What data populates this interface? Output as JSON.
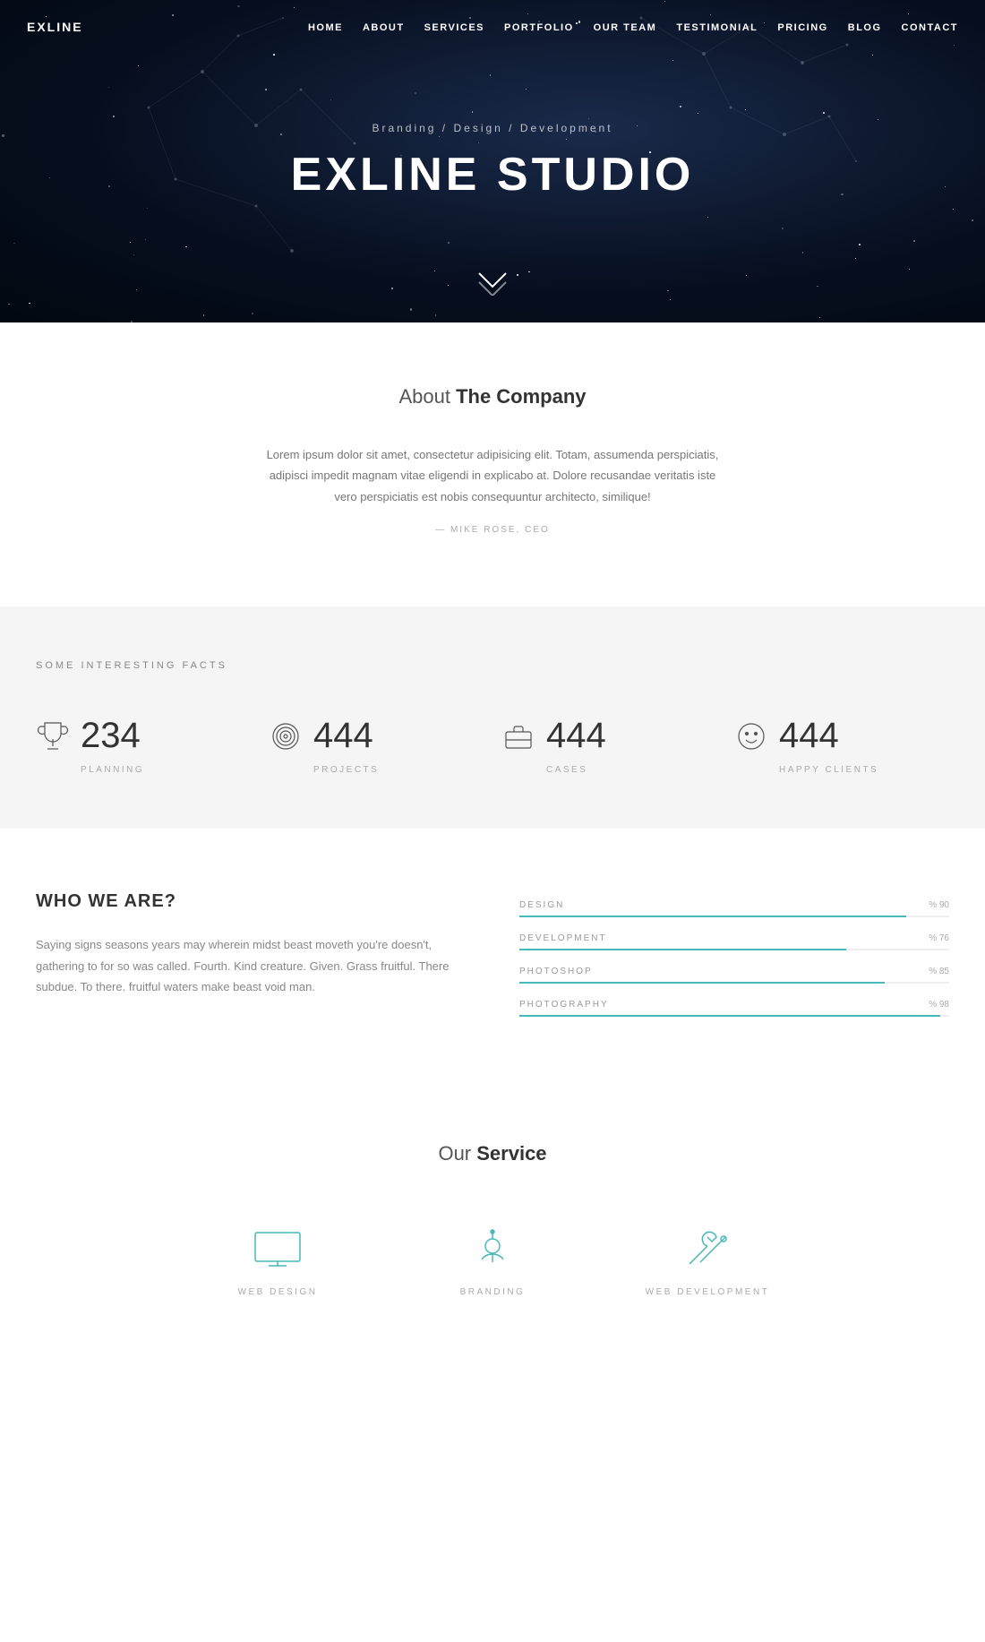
{
  "navbar": {
    "logo": "EXLINE",
    "items": [
      {
        "label": "HOME",
        "href": "#"
      },
      {
        "label": "ABOUT",
        "href": "#"
      },
      {
        "label": "SERVICES",
        "href": "#"
      },
      {
        "label": "PORTFOLIO",
        "href": "#"
      },
      {
        "label": "OUR TEAM",
        "href": "#"
      },
      {
        "label": "TESTIMONIAL",
        "href": "#"
      },
      {
        "label": "PRICING",
        "href": "#"
      },
      {
        "label": "BLOG",
        "href": "#"
      },
      {
        "label": "CONTACT",
        "href": "#"
      }
    ]
  },
  "hero": {
    "subtitle": "Branding / Design / Development",
    "title": "EXLINE STUDIO"
  },
  "about": {
    "title_plain": "About ",
    "title_bold": "The Company",
    "body": "Lorem ipsum dolor sit amet, consectetur adipisicing elit. Totam, assumenda perspiciatis, adipisci impedit magnam vitae eligendi in explicabo at. Dolore recusandae veritatis iste vero perspiciatis est nobis consequuntur architecto, similique!",
    "author": "— MIKE ROSE, CEO"
  },
  "facts": {
    "heading": "SOME INTERESTING FACTS",
    "items": [
      {
        "number": "234",
        "label": "PLANNING"
      },
      {
        "number": "444",
        "label": "PROJECTS"
      },
      {
        "number": "444",
        "label": "CASES"
      },
      {
        "number": "444",
        "label": "HAPPY CLIENTS"
      }
    ]
  },
  "skills": {
    "title": "WHO WE ARE?",
    "body": "Saying signs seasons years may wherein midst beast moveth you're doesn't, gathering to for so was called. Fourth. Kind creature. Given. Grass fruitful. There subdue. To there. fruitful waters make beast void man.",
    "bars": [
      {
        "name": "DESIGN",
        "pct": 90,
        "label": "% 90"
      },
      {
        "name": "DEVELOPMENT",
        "pct": 76,
        "label": "% 76"
      },
      {
        "name": "PHOTOSHOP",
        "pct": 85,
        "label": "% 85"
      },
      {
        "name": "PHOTOGRAPHY",
        "pct": 98,
        "label": "% 98"
      }
    ]
  },
  "services": {
    "title_plain": "Our ",
    "title_bold": "Service",
    "items": [
      {
        "label": "WEB DESIGN"
      },
      {
        "label": "BRANDING"
      },
      {
        "label": "WEB DEVELOPMENT"
      }
    ]
  }
}
